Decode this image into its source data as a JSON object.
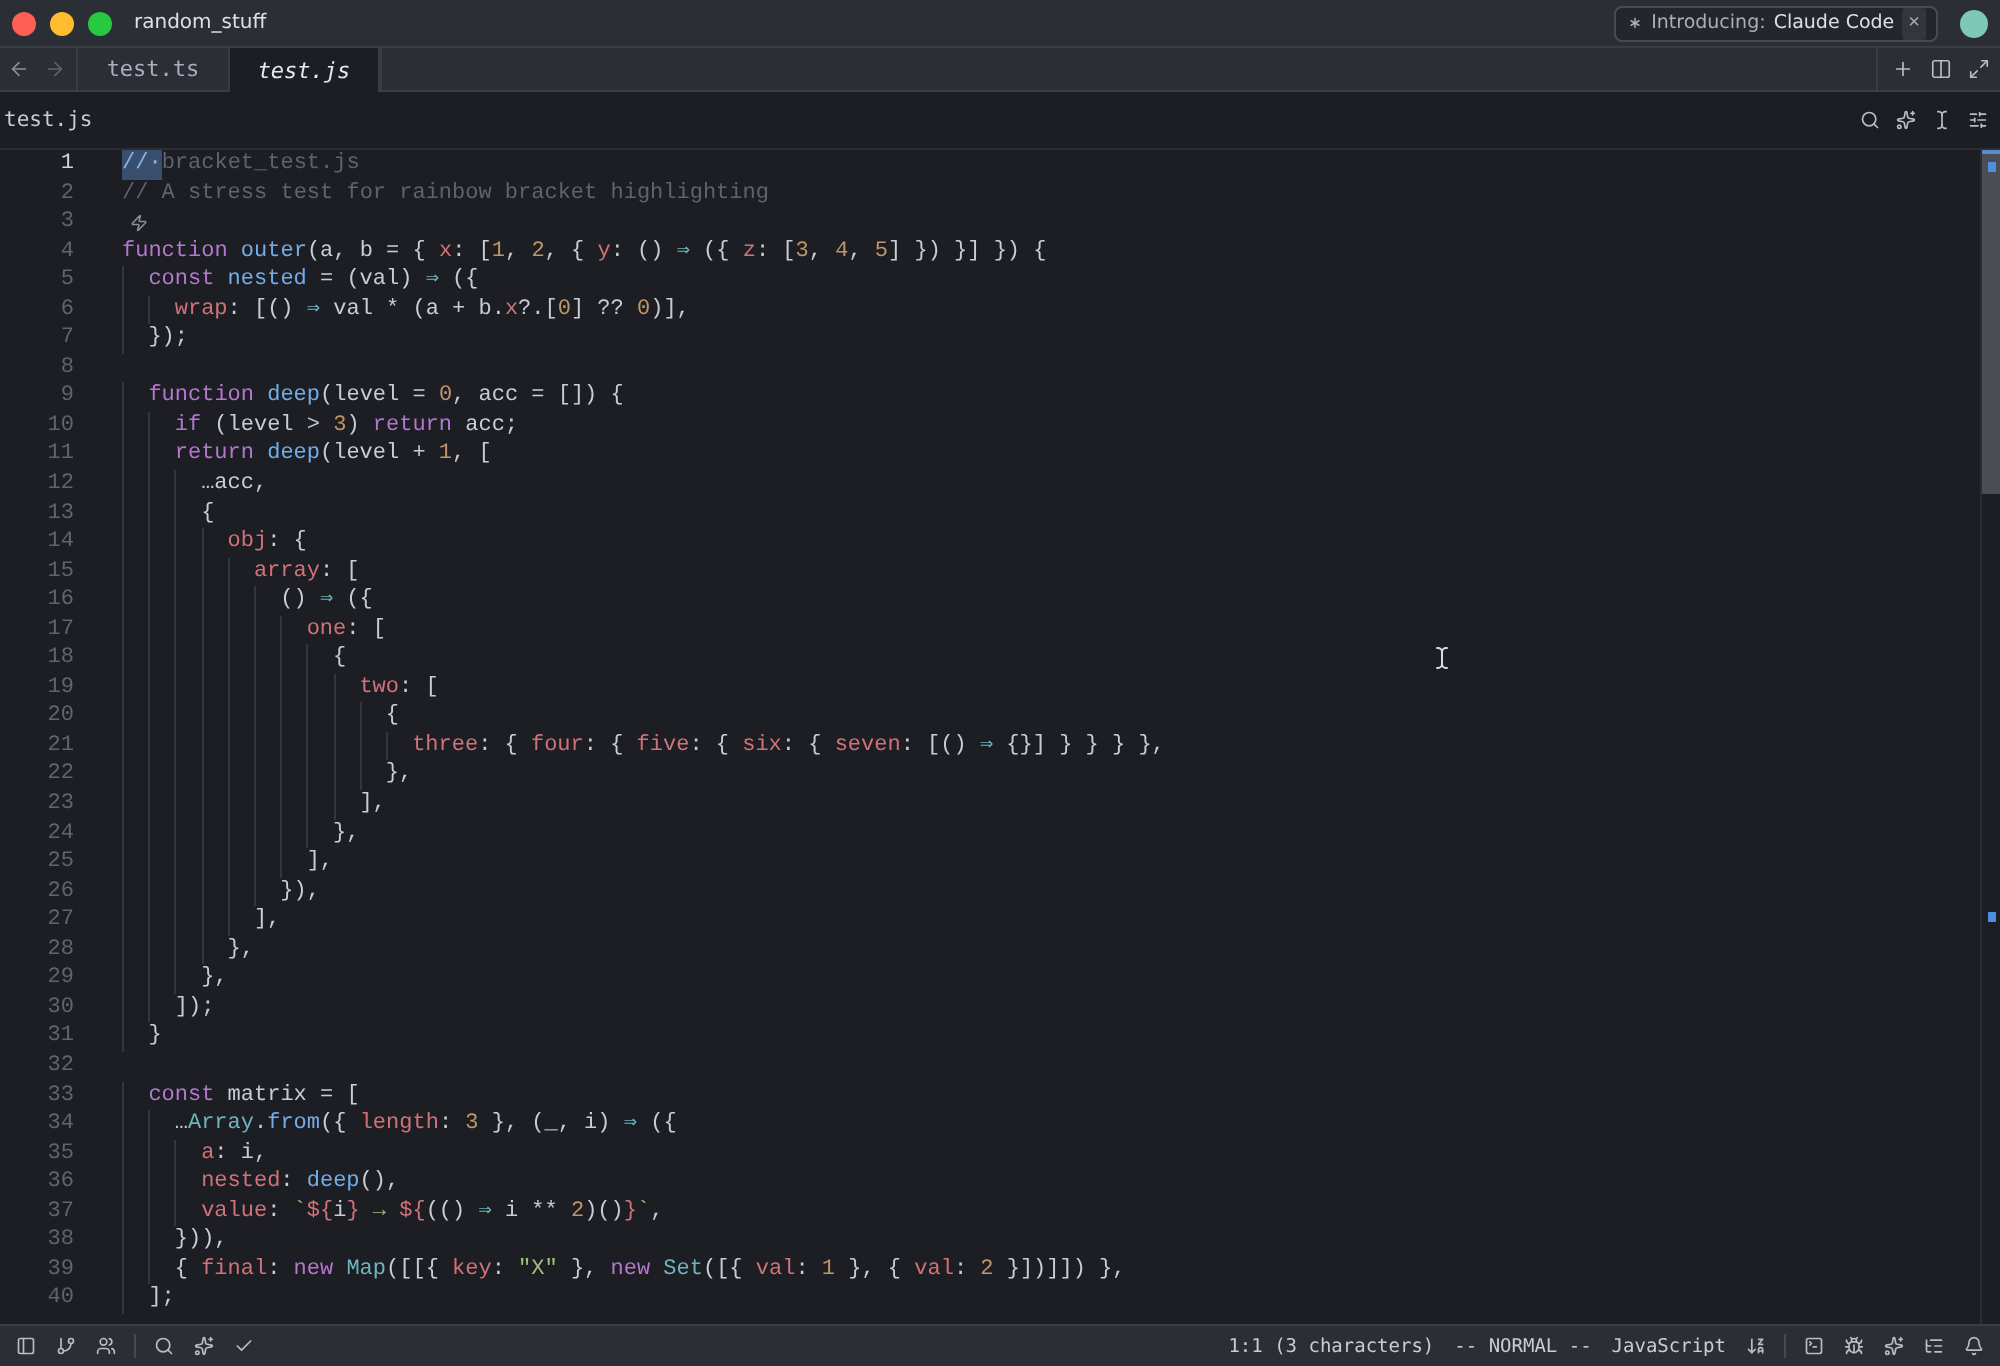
{
  "title_bar": {
    "project": "random_stuff",
    "banner": {
      "prefix": "Introducing:",
      "name": "Claude Code",
      "close": "×"
    }
  },
  "tabs": [
    {
      "label": "test.ts",
      "selected": false
    },
    {
      "label": "test.js",
      "selected": true
    }
  ],
  "breadcrumb": "test.js",
  "editor": {
    "lines": [
      {
        "number": "1",
        "current": true,
        "tokens": [
          {
            "kind": "selection",
            "text": "//·"
          },
          {
            "kind": "comment",
            "text": "bracket_test.js"
          }
        ]
      },
      {
        "number": "2",
        "current": false,
        "tokens": [
          {
            "kind": "comment",
            "text": "// A stress test for rainbow bracket highlighting"
          }
        ]
      },
      {
        "number": "3",
        "current": false,
        "tokens": [
          {
            "kind": "hint-icon"
          }
        ]
      },
      {
        "number": "4",
        "current": false,
        "tokens": [
          {
            "kind": "keyword",
            "text": "function "
          },
          {
            "kind": "function",
            "text": "outer"
          },
          {
            "kind": "plain",
            "text": "(a, b = { "
          },
          {
            "kind": "property",
            "text": "x"
          },
          {
            "kind": "plain",
            "text": ": ["
          },
          {
            "kind": "number",
            "text": "1"
          },
          {
            "kind": "plain",
            "text": ", "
          },
          {
            "kind": "number",
            "text": "2"
          },
          {
            "kind": "plain",
            "text": ", { "
          },
          {
            "kind": "property",
            "text": "y"
          },
          {
            "kind": "plain",
            "text": ": () "
          },
          {
            "kind": "arrow",
            "text": "⇒"
          },
          {
            "kind": "plain",
            "text": " ({ "
          },
          {
            "kind": "property",
            "text": "z"
          },
          {
            "kind": "plain",
            "text": ": ["
          },
          {
            "kind": "number",
            "text": "3"
          },
          {
            "kind": "plain",
            "text": ", "
          },
          {
            "kind": "number",
            "text": "4"
          },
          {
            "kind": "plain",
            "text": ", "
          },
          {
            "kind": "number",
            "text": "5"
          },
          {
            "kind": "plain",
            "text": "] }) }] }) {"
          }
        ]
      },
      {
        "number": "5",
        "current": false,
        "tokens": [
          {
            "kind": "keyword",
            "text": "  const "
          },
          {
            "kind": "function",
            "text": "nested"
          },
          {
            "kind": "plain",
            "text": " = (val) "
          },
          {
            "kind": "arrow",
            "text": "⇒"
          },
          {
            "kind": "plain",
            "text": " ({"
          }
        ]
      },
      {
        "number": "6",
        "current": false,
        "tokens": [
          {
            "kind": "property",
            "text": "    wrap"
          },
          {
            "kind": "plain",
            "text": ": [() "
          },
          {
            "kind": "arrow",
            "text": "⇒"
          },
          {
            "kind": "plain",
            "text": " val * (a + b."
          },
          {
            "kind": "property",
            "text": "x"
          },
          {
            "kind": "plain",
            "text": "?.["
          },
          {
            "kind": "number",
            "text": "0"
          },
          {
            "kind": "plain",
            "text": "] ?? "
          },
          {
            "kind": "number",
            "text": "0"
          },
          {
            "kind": "plain",
            "text": ")],"
          }
        ]
      },
      {
        "number": "7",
        "current": false,
        "tokens": [
          {
            "kind": "plain",
            "text": "  });"
          }
        ]
      },
      {
        "number": "8",
        "current": false
      },
      {
        "number": "9",
        "current": false,
        "tokens": [
          {
            "kind": "keyword",
            "text": "  function "
          },
          {
            "kind": "function",
            "text": "deep"
          },
          {
            "kind": "plain",
            "text": "(level = "
          },
          {
            "kind": "number",
            "text": "0"
          },
          {
            "kind": "plain",
            "text": ", acc = []) {"
          }
        ]
      },
      {
        "number": "10",
        "current": false,
        "tokens": [
          {
            "kind": "keyword",
            "text": "    if"
          },
          {
            "kind": "plain",
            "text": " (level > "
          },
          {
            "kind": "number",
            "text": "3"
          },
          {
            "kind": "plain",
            "text": ") "
          },
          {
            "kind": "keyword",
            "text": "return"
          },
          {
            "kind": "plain",
            "text": " acc;"
          }
        ]
      },
      {
        "number": "11",
        "current": false,
        "tokens": [
          {
            "kind": "keyword",
            "text": "    return "
          },
          {
            "kind": "function",
            "text": "deep"
          },
          {
            "kind": "plain",
            "text": "(level + "
          },
          {
            "kind": "number",
            "text": "1"
          },
          {
            "kind": "plain",
            "text": ", ["
          }
        ]
      },
      {
        "number": "12",
        "current": false,
        "tokens": [
          {
            "kind": "plain",
            "text": "      …acc,"
          }
        ]
      },
      {
        "number": "13",
        "current": false,
        "tokens": [
          {
            "kind": "plain",
            "text": "      {"
          }
        ]
      },
      {
        "number": "14",
        "current": false,
        "tokens": [
          {
            "kind": "property",
            "text": "        obj"
          },
          {
            "kind": "plain",
            "text": ": {"
          }
        ]
      },
      {
        "number": "15",
        "current": false,
        "tokens": [
          {
            "kind": "property",
            "text": "          array"
          },
          {
            "kind": "plain",
            "text": ": ["
          }
        ]
      },
      {
        "number": "16",
        "current": false,
        "tokens": [
          {
            "kind": "plain",
            "text": "            () "
          },
          {
            "kind": "arrow",
            "text": "⇒"
          },
          {
            "kind": "plain",
            "text": " ({"
          }
        ]
      },
      {
        "number": "17",
        "current": false,
        "tokens": [
          {
            "kind": "property",
            "text": "              one"
          },
          {
            "kind": "plain",
            "text": ": ["
          }
        ]
      },
      {
        "number": "18",
        "current": false,
        "tokens": [
          {
            "kind": "plain",
            "text": "                {"
          }
        ]
      },
      {
        "number": "19",
        "current": false,
        "tokens": [
          {
            "kind": "property",
            "text": "                  two"
          },
          {
            "kind": "plain",
            "text": ": ["
          }
        ]
      },
      {
        "number": "20",
        "current": false,
        "tokens": [
          {
            "kind": "plain",
            "text": "                    {"
          }
        ]
      },
      {
        "number": "21",
        "current": false,
        "tokens": [
          {
            "kind": "property",
            "text": "                      three"
          },
          {
            "kind": "plain",
            "text": ": { "
          },
          {
            "kind": "property",
            "text": "four"
          },
          {
            "kind": "plain",
            "text": ": { "
          },
          {
            "kind": "property",
            "text": "five"
          },
          {
            "kind": "plain",
            "text": ": { "
          },
          {
            "kind": "property",
            "text": "six"
          },
          {
            "kind": "plain",
            "text": ": { "
          },
          {
            "kind": "property",
            "text": "seven"
          },
          {
            "kind": "plain",
            "text": ": [() "
          },
          {
            "kind": "arrow",
            "text": "⇒"
          },
          {
            "kind": "plain",
            "text": " {}] } } } },"
          }
        ]
      },
      {
        "number": "22",
        "current": false,
        "tokens": [
          {
            "kind": "plain",
            "text": "                    },"
          }
        ]
      },
      {
        "number": "23",
        "current": false,
        "tokens": [
          {
            "kind": "plain",
            "text": "                  ],"
          }
        ]
      },
      {
        "number": "24",
        "current": false,
        "tokens": [
          {
            "kind": "plain",
            "text": "                },"
          }
        ]
      },
      {
        "number": "25",
        "current": false,
        "tokens": [
          {
            "kind": "plain",
            "text": "              ],"
          }
        ]
      },
      {
        "number": "26",
        "current": false,
        "tokens": [
          {
            "kind": "plain",
            "text": "            }),"
          }
        ]
      },
      {
        "number": "27",
        "current": false,
        "tokens": [
          {
            "kind": "plain",
            "text": "          ],"
          }
        ]
      },
      {
        "number": "28",
        "current": false,
        "tokens": [
          {
            "kind": "plain",
            "text": "        },"
          }
        ]
      },
      {
        "number": "29",
        "current": false,
        "tokens": [
          {
            "kind": "plain",
            "text": "      },"
          }
        ]
      },
      {
        "number": "30",
        "current": false,
        "tokens": [
          {
            "kind": "plain",
            "text": "    ]);"
          }
        ]
      },
      {
        "number": "31",
        "current": false,
        "tokens": [
          {
            "kind": "plain",
            "text": "  }"
          }
        ]
      },
      {
        "number": "32",
        "current": false
      },
      {
        "number": "33",
        "current": false,
        "tokens": [
          {
            "kind": "keyword",
            "text": "  const"
          },
          {
            "kind": "plain",
            "text": " matrix = ["
          }
        ]
      },
      {
        "number": "34",
        "current": false,
        "tokens": [
          {
            "kind": "plain",
            "text": "    …"
          },
          {
            "kind": "type",
            "text": "Array"
          },
          {
            "kind": "plain",
            "text": "."
          },
          {
            "kind": "function",
            "text": "from"
          },
          {
            "kind": "plain",
            "text": "({ "
          },
          {
            "kind": "property",
            "text": "length"
          },
          {
            "kind": "plain",
            "text": ": "
          },
          {
            "kind": "number",
            "text": "3"
          },
          {
            "kind": "plain",
            "text": " }, (_, i) "
          },
          {
            "kind": "arrow",
            "text": "⇒"
          },
          {
            "kind": "plain",
            "text": " ({"
          }
        ]
      },
      {
        "number": "35",
        "current": false,
        "tokens": [
          {
            "kind": "property",
            "text": "      a"
          },
          {
            "kind": "plain",
            "text": ": i,"
          }
        ]
      },
      {
        "number": "36",
        "current": false,
        "tokens": [
          {
            "kind": "property",
            "text": "      nested"
          },
          {
            "kind": "plain",
            "text": ": "
          },
          {
            "kind": "function",
            "text": "deep"
          },
          {
            "kind": "plain",
            "text": "(),"
          }
        ]
      },
      {
        "number": "37",
        "current": false,
        "tokens": [
          {
            "kind": "property",
            "text": "      value"
          },
          {
            "kind": "plain",
            "text": ": "
          },
          {
            "kind": "string",
            "text": "`"
          },
          {
            "kind": "interpolation",
            "text": "${"
          },
          {
            "kind": "plain",
            "text": "i"
          },
          {
            "kind": "interpolation",
            "text": "}"
          },
          {
            "kind": "string",
            "text": " → "
          },
          {
            "kind": "interpolation",
            "text": "${"
          },
          {
            "kind": "plain",
            "text": "(() "
          },
          {
            "kind": "arrow",
            "text": "⇒"
          },
          {
            "kind": "plain",
            "text": " i ** "
          },
          {
            "kind": "number",
            "text": "2"
          },
          {
            "kind": "plain",
            "text": ")()"
          },
          {
            "kind": "interpolation",
            "text": "}"
          },
          {
            "kind": "string",
            "text": "`"
          },
          {
            "kind": "plain",
            "text": ","
          }
        ]
      },
      {
        "number": "38",
        "current": false,
        "tokens": [
          {
            "kind": "plain",
            "text": "    })),"
          }
        ]
      },
      {
        "number": "39",
        "current": false,
        "tokens": [
          {
            "kind": "plain",
            "text": "    { "
          },
          {
            "kind": "property",
            "text": "final"
          },
          {
            "kind": "plain",
            "text": ": "
          },
          {
            "kind": "keyword",
            "text": "new "
          },
          {
            "kind": "type",
            "text": "Map"
          },
          {
            "kind": "plain",
            "text": "([[{ "
          },
          {
            "kind": "property",
            "text": "key"
          },
          {
            "kind": "plain",
            "text": ": "
          },
          {
            "kind": "string",
            "text": "\"X\""
          },
          {
            "kind": "plain",
            "text": " }, "
          },
          {
            "kind": "keyword",
            "text": "new "
          },
          {
            "kind": "type",
            "text": "Set"
          },
          {
            "kind": "plain",
            "text": "([{ "
          },
          {
            "kind": "property",
            "text": "val"
          },
          {
            "kind": "plain",
            "text": ": "
          },
          {
            "kind": "number",
            "text": "1"
          },
          {
            "kind": "plain",
            "text": " }, { "
          },
          {
            "kind": "property",
            "text": "val"
          },
          {
            "kind": "plain",
            "text": ": "
          },
          {
            "kind": "number",
            "text": "2"
          },
          {
            "kind": "plain",
            "text": " }])]]) },"
          }
        ]
      },
      {
        "number": "40",
        "current": false,
        "tokens": [
          {
            "kind": "plain",
            "text": "  ];"
          }
        ]
      }
    ]
  },
  "status_bar": {
    "position": "1:1 (3 characters)",
    "mode": "-- NORMAL --",
    "language": "JavaScript"
  }
}
